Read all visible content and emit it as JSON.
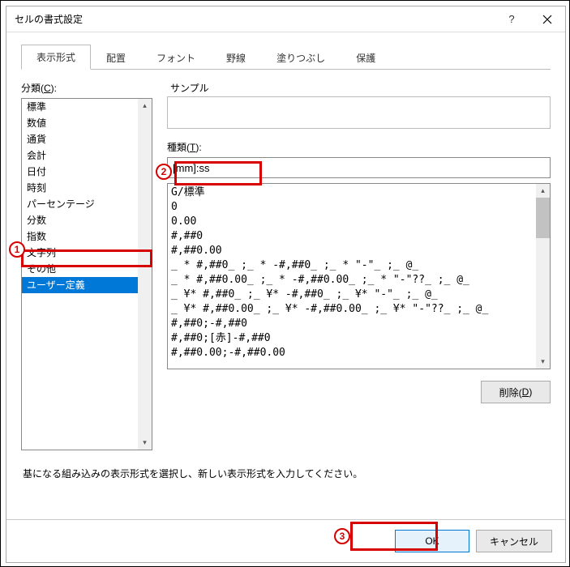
{
  "title": "セルの書式設定",
  "tabs": [
    "表示形式",
    "配置",
    "フォント",
    "野線",
    "塗りつぶし",
    "保護"
  ],
  "active_tab_index": 0,
  "category_label": "分類(C):",
  "category_underline": "C",
  "categories": [
    "標準",
    "数値",
    "通貨",
    "会計",
    "日付",
    "時刻",
    "パーセンテージ",
    "分数",
    "指数",
    "文字列",
    "その他",
    "ユーザー定義"
  ],
  "selected_category_index": 11,
  "sample_label": "サンプル",
  "type_label": "種類(T):",
  "type_underline": "T",
  "type_value": "[mm]:ss",
  "format_codes": [
    "G/標準",
    "0",
    "0.00",
    "#,##0",
    "#,##0.00",
    "_ * #,##0_ ;_ * -#,##0_ ;_ * \"-\"_ ;_ @_ ",
    "_ * #,##0.00_ ;_ * -#,##0.00_ ;_ * \"-\"??_ ;_ @_ ",
    "_ ¥* #,##0_ ;_ ¥* -#,##0_ ;_ ¥* \"-\"_ ;_ @_ ",
    "_ ¥* #,##0.00_ ;_ ¥* -#,##0.00_ ;_ ¥* \"-\"??_ ;_ @_ ",
    "#,##0;-#,##0",
    "#,##0;[赤]-#,##0",
    "#,##0.00;-#,##0.00"
  ],
  "delete_label": "削除(D)",
  "delete_underline": "D",
  "help_text": "基になる組み込みの表示形式を選択し、新しい表示形式を入力してください。",
  "ok_label": "OK",
  "cancel_label": "キャンセル",
  "annotations": {
    "1": "1",
    "2": "2",
    "3": "3"
  }
}
